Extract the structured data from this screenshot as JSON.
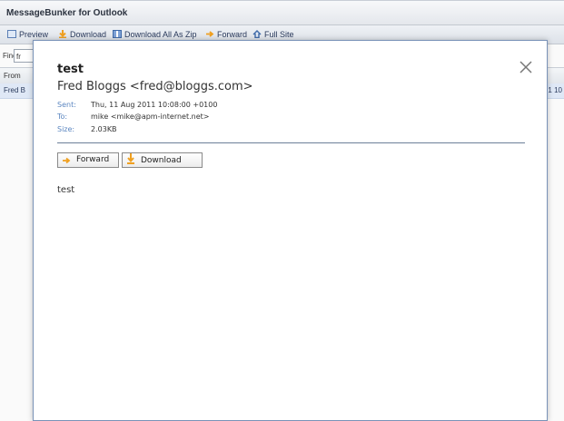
{
  "app": {
    "title": "MessageBunker for Outlook",
    "toolbar": {
      "preview": "Preview",
      "download": "Download",
      "download_zip": "Download All As Zip",
      "forward": "Forward",
      "full_site": "Full Site"
    },
    "find_label": "Find",
    "find_value": "fr",
    "grid": {
      "from_header": "From",
      "row_from": "Fred B",
      "row_date": "1 10"
    }
  },
  "modal": {
    "subject": "test",
    "from": "Fred Bloggs <fred@bloggs.com>",
    "sent_label": "Sent:",
    "sent_value": "Thu, 11 Aug 2011 10:08:00 +0100",
    "to_label": "To:",
    "to_value": "mike <mike@apm-internet.net>",
    "size_label": "Size:",
    "size_value": "2.03KB",
    "forward_button": "Forward",
    "download_button": "Download",
    "body": "test",
    "close_icon": "close-icon"
  },
  "colors": {
    "accent": "#5b86c0",
    "modal_border": "#7a93b8",
    "selected_row": "#dfe8f6",
    "download_orange": "#f0a020"
  }
}
